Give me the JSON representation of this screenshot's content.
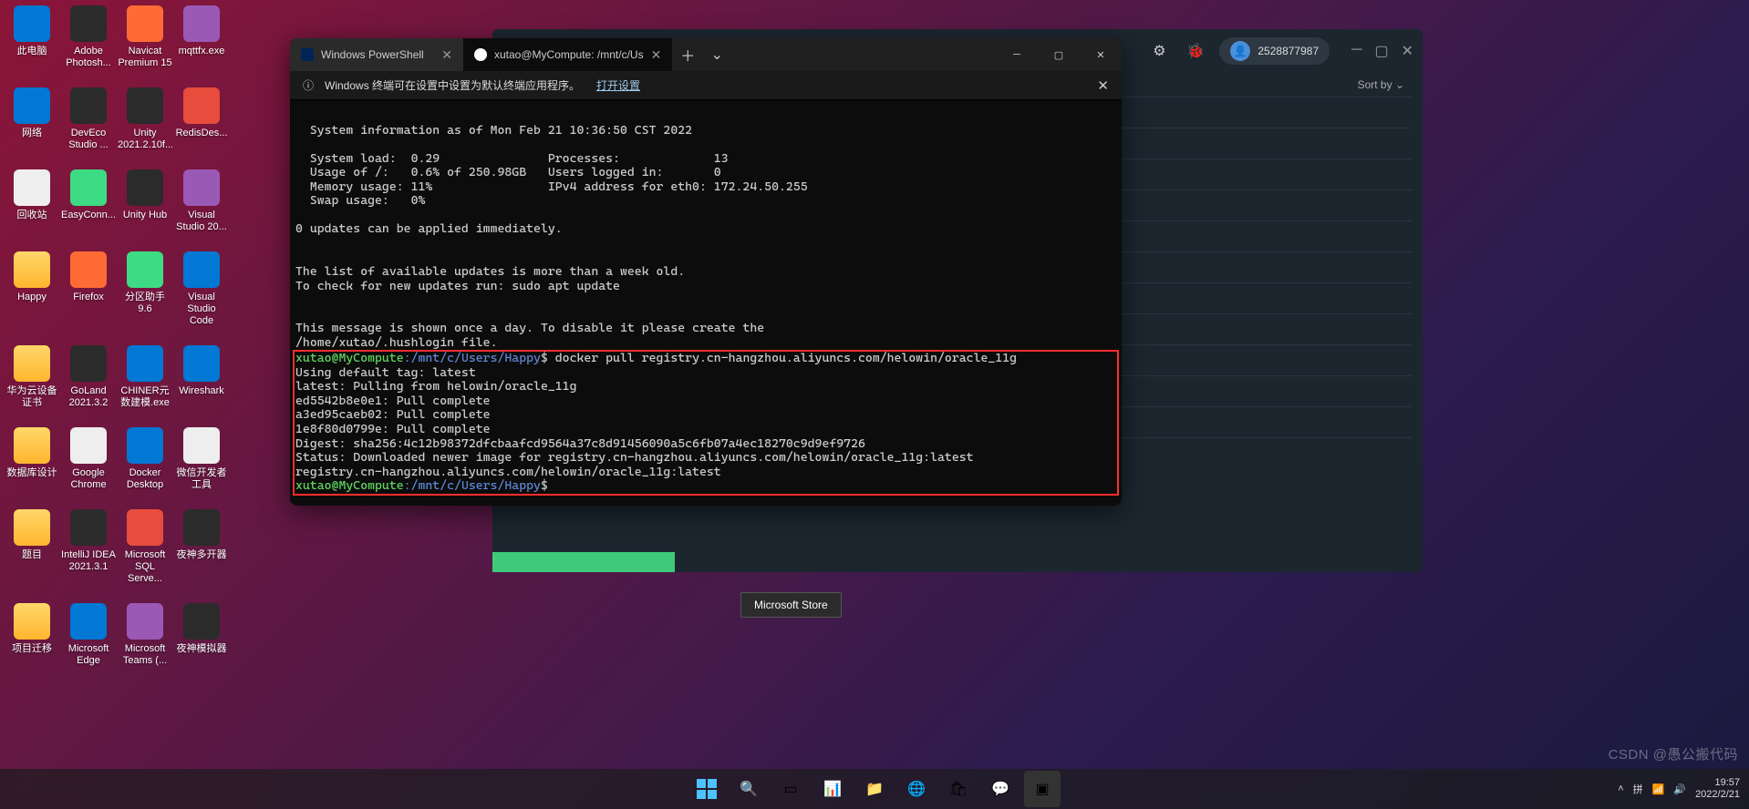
{
  "desktop_icons": [
    [
      "此电脑",
      "blue"
    ],
    [
      "Adobe Photosh...",
      "dark"
    ],
    [
      "Navicat Premium 15",
      "orange"
    ],
    [
      "mqttfx.exe",
      "purple"
    ],
    [
      "网络",
      "blue"
    ],
    [
      "DevEco Studio ...",
      "dark"
    ],
    [
      "Unity 2021.2.10f...",
      "dark"
    ],
    [
      "RedisDes...",
      "red"
    ],
    [
      "回收站",
      "white"
    ],
    [
      "EasyConn...",
      "green"
    ],
    [
      "Unity Hub",
      "dark"
    ],
    [
      "Visual Studio 20...",
      "purple"
    ],
    [
      "Happy",
      "folder"
    ],
    [
      "Firefox",
      "orange"
    ],
    [
      "分区助手 9.6",
      "green"
    ],
    [
      "Visual Studio Code",
      "blue"
    ],
    [
      "华为云设备证书",
      "folder"
    ],
    [
      "GoLand 2021.3.2",
      "dark"
    ],
    [
      "CHINER元数建模.exe",
      "blue"
    ],
    [
      "Wireshark",
      "blue"
    ],
    [
      "数据库设计",
      "folder"
    ],
    [
      "Google Chrome",
      "white"
    ],
    [
      "Docker Desktop",
      "blue"
    ],
    [
      "微信开发者工具",
      "white"
    ],
    [
      "题目",
      "folder"
    ],
    [
      "IntelliJ IDEA 2021.3.1",
      "dark"
    ],
    [
      "Microsoft SQL Serve...",
      "red"
    ],
    [
      "夜神多开器",
      "dark"
    ],
    [
      "项目迁移",
      "folder"
    ],
    [
      "Microsoft Edge",
      "blue"
    ],
    [
      "Microsoft Teams (...",
      "purple"
    ],
    [
      "夜神模拟器",
      "dark"
    ]
  ],
  "docker": {
    "user": "2528877987",
    "sort": "Sort by ⌄"
  },
  "terminal": {
    "tab1": "Windows PowerShell",
    "tab2": "xutao@MyCompute: /mnt/c/Us",
    "info_text": "Windows 终端可在设置中设置为默认终端应用程序。",
    "info_link": "打开设置",
    "body": {
      "l1": "  System information as of Mon Feb 21 10:36:50 CST 2022",
      "l2": "  System load:  0.29               Processes:             13",
      "l3": "  Usage of /:   0.6% of 250.98GB   Users logged in:       0",
      "l4": "  Memory usage: 11%                IPv4 address for eth0: 172.24.50.255",
      "l5": "  Swap usage:   0%",
      "l6": "0 updates can be applied immediately.",
      "l7": "The list of available updates is more than a week old.",
      "l8": "To check for new updates run: sudo apt update",
      "l9": "This message is shown once a day. To disable it please create the",
      "l10": "/home/xutao/.hushlogin file.",
      "prompt_user": "xutao@MyCompute",
      "prompt_path": ":/mnt/c/Users/Happy",
      "cmd": "$ docker pull registry.cn-hangzhou.aliyuncs.com/helowin/oracle_11g",
      "r1": "Using default tag: latest",
      "r2": "latest: Pulling from helowin/oracle_11g",
      "r3": "ed5542b8e0e1: Pull complete",
      "r4": "a3ed95caeb02: Pull complete",
      "r5": "1e8f80d0799e: Pull complete",
      "r6": "Digest: sha256:4c12b98372dfcbaafcd9564a37c8d91456090a5c6fb07a4ec18270c9d9ef9726",
      "r7": "Status: Downloaded newer image for registry.cn-hangzhou.aliyuncs.com/helowin/oracle_11g:latest",
      "r8": "registry.cn-hangzhou.aliyuncs.com/helowin/oracle_11g:latest",
      "prompt2": "$"
    }
  },
  "tooltip": "Microsoft Store",
  "taskbar": {
    "time": "19:57",
    "date": "2022/2/21"
  },
  "watermark": "CSDN @愚公搬代码"
}
